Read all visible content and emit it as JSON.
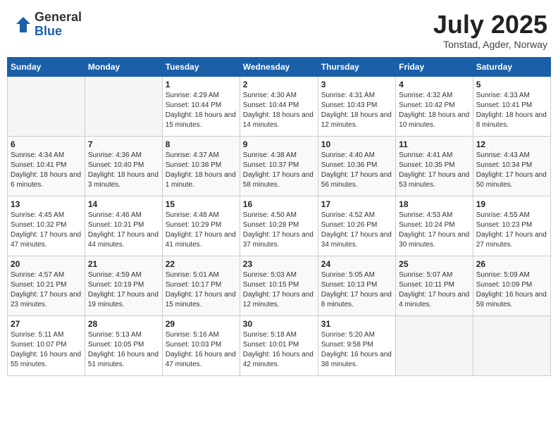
{
  "header": {
    "logo_general": "General",
    "logo_blue": "Blue",
    "month_title": "July 2025",
    "location": "Tonstad, Agder, Norway"
  },
  "days_of_week": [
    "Sunday",
    "Monday",
    "Tuesday",
    "Wednesday",
    "Thursday",
    "Friday",
    "Saturday"
  ],
  "weeks": [
    [
      {
        "day": "",
        "info": ""
      },
      {
        "day": "",
        "info": ""
      },
      {
        "day": "1",
        "info": "Sunrise: 4:29 AM\nSunset: 10:44 PM\nDaylight: 18 hours and 15 minutes."
      },
      {
        "day": "2",
        "info": "Sunrise: 4:30 AM\nSunset: 10:44 PM\nDaylight: 18 hours and 14 minutes."
      },
      {
        "day": "3",
        "info": "Sunrise: 4:31 AM\nSunset: 10:43 PM\nDaylight: 18 hours and 12 minutes."
      },
      {
        "day": "4",
        "info": "Sunrise: 4:32 AM\nSunset: 10:42 PM\nDaylight: 18 hours and 10 minutes."
      },
      {
        "day": "5",
        "info": "Sunrise: 4:33 AM\nSunset: 10:41 PM\nDaylight: 18 hours and 8 minutes."
      }
    ],
    [
      {
        "day": "6",
        "info": "Sunrise: 4:34 AM\nSunset: 10:41 PM\nDaylight: 18 hours and 6 minutes."
      },
      {
        "day": "7",
        "info": "Sunrise: 4:36 AM\nSunset: 10:40 PM\nDaylight: 18 hours and 3 minutes."
      },
      {
        "day": "8",
        "info": "Sunrise: 4:37 AM\nSunset: 10:38 PM\nDaylight: 18 hours and 1 minute."
      },
      {
        "day": "9",
        "info": "Sunrise: 4:38 AM\nSunset: 10:37 PM\nDaylight: 17 hours and 58 minutes."
      },
      {
        "day": "10",
        "info": "Sunrise: 4:40 AM\nSunset: 10:36 PM\nDaylight: 17 hours and 56 minutes."
      },
      {
        "day": "11",
        "info": "Sunrise: 4:41 AM\nSunset: 10:35 PM\nDaylight: 17 hours and 53 minutes."
      },
      {
        "day": "12",
        "info": "Sunrise: 4:43 AM\nSunset: 10:34 PM\nDaylight: 17 hours and 50 minutes."
      }
    ],
    [
      {
        "day": "13",
        "info": "Sunrise: 4:45 AM\nSunset: 10:32 PM\nDaylight: 17 hours and 47 minutes."
      },
      {
        "day": "14",
        "info": "Sunrise: 4:46 AM\nSunset: 10:31 PM\nDaylight: 17 hours and 44 minutes."
      },
      {
        "day": "15",
        "info": "Sunrise: 4:48 AM\nSunset: 10:29 PM\nDaylight: 17 hours and 41 minutes."
      },
      {
        "day": "16",
        "info": "Sunrise: 4:50 AM\nSunset: 10:28 PM\nDaylight: 17 hours and 37 minutes."
      },
      {
        "day": "17",
        "info": "Sunrise: 4:52 AM\nSunset: 10:26 PM\nDaylight: 17 hours and 34 minutes."
      },
      {
        "day": "18",
        "info": "Sunrise: 4:53 AM\nSunset: 10:24 PM\nDaylight: 17 hours and 30 minutes."
      },
      {
        "day": "19",
        "info": "Sunrise: 4:55 AM\nSunset: 10:23 PM\nDaylight: 17 hours and 27 minutes."
      }
    ],
    [
      {
        "day": "20",
        "info": "Sunrise: 4:57 AM\nSunset: 10:21 PM\nDaylight: 17 hours and 23 minutes."
      },
      {
        "day": "21",
        "info": "Sunrise: 4:59 AM\nSunset: 10:19 PM\nDaylight: 17 hours and 19 minutes."
      },
      {
        "day": "22",
        "info": "Sunrise: 5:01 AM\nSunset: 10:17 PM\nDaylight: 17 hours and 15 minutes."
      },
      {
        "day": "23",
        "info": "Sunrise: 5:03 AM\nSunset: 10:15 PM\nDaylight: 17 hours and 12 minutes."
      },
      {
        "day": "24",
        "info": "Sunrise: 5:05 AM\nSunset: 10:13 PM\nDaylight: 17 hours and 8 minutes."
      },
      {
        "day": "25",
        "info": "Sunrise: 5:07 AM\nSunset: 10:11 PM\nDaylight: 17 hours and 4 minutes."
      },
      {
        "day": "26",
        "info": "Sunrise: 5:09 AM\nSunset: 10:09 PM\nDaylight: 16 hours and 59 minutes."
      }
    ],
    [
      {
        "day": "27",
        "info": "Sunrise: 5:11 AM\nSunset: 10:07 PM\nDaylight: 16 hours and 55 minutes."
      },
      {
        "day": "28",
        "info": "Sunrise: 5:13 AM\nSunset: 10:05 PM\nDaylight: 16 hours and 51 minutes."
      },
      {
        "day": "29",
        "info": "Sunrise: 5:16 AM\nSunset: 10:03 PM\nDaylight: 16 hours and 47 minutes."
      },
      {
        "day": "30",
        "info": "Sunrise: 5:18 AM\nSunset: 10:01 PM\nDaylight: 16 hours and 42 minutes."
      },
      {
        "day": "31",
        "info": "Sunrise: 5:20 AM\nSunset: 9:58 PM\nDaylight: 16 hours and 38 minutes."
      },
      {
        "day": "",
        "info": ""
      },
      {
        "day": "",
        "info": ""
      }
    ]
  ]
}
